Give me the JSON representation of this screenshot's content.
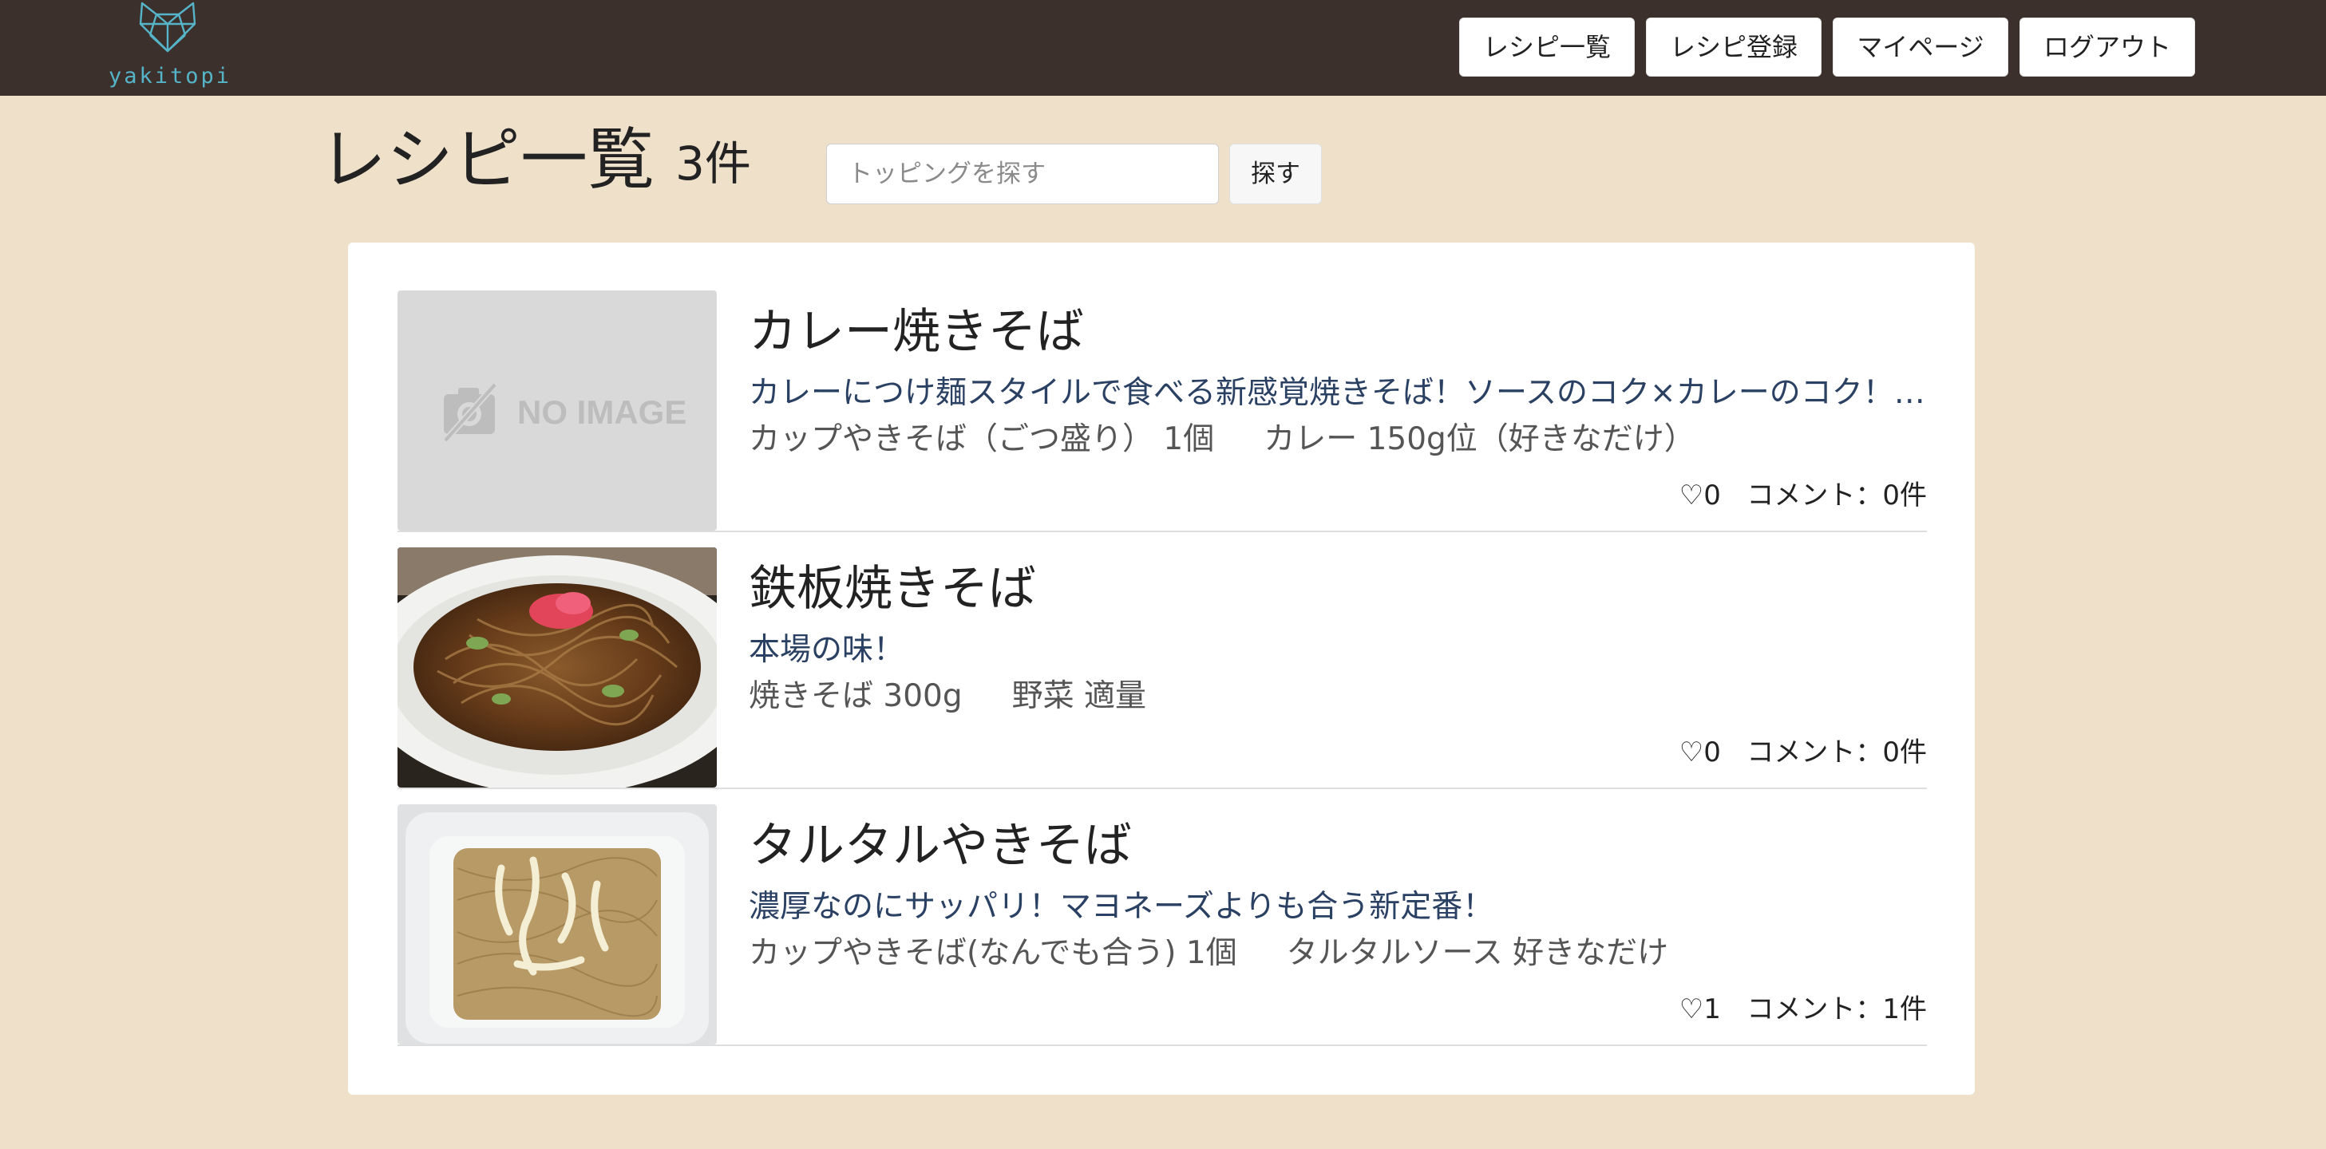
{
  "header": {
    "logo_text": "yakitopi",
    "nav": [
      "レシピ一覧",
      "レシピ登録",
      "マイページ",
      "ログアウト"
    ]
  },
  "page": {
    "title": "レシピ一覧",
    "count": "3件",
    "search_placeholder": "トッピングを探す",
    "search_button": "探す"
  },
  "recipes": [
    {
      "title": "カレー焼きそば",
      "description": "カレーにつけ麺スタイルで食べる新感覚焼きそば！ソースのコク×カレーのコク！お…",
      "ingredients": "カップやきそば（ごつ盛り） 1個     カレー 150g位（好きなだけ）",
      "likes": "♡0",
      "comments": "コメント：0件",
      "image": "no-image",
      "no_image_text": "NO IMAGE"
    },
    {
      "title": "鉄板焼きそば",
      "description": "本場の味！",
      "ingredients": "焼きそば 300g     野菜 適量",
      "likes": "♡0",
      "comments": "コメント：0件",
      "image": "yakisoba-plate-photo"
    },
    {
      "title": "タルタルやきそば",
      "description": "濃厚なのにサッパリ！マヨネーズよりも合う新定番！",
      "ingredients": "カップやきそば(なんでも合う) 1個     タルタルソース 好きなだけ",
      "likes": "♡1",
      "comments": "コメント：1件",
      "image": "cup-yakisoba-photo"
    }
  ],
  "colors": {
    "background": "#efe0ca",
    "header": "#3c302c",
    "logo": "#55b4c8",
    "description": "#2b4163"
  }
}
